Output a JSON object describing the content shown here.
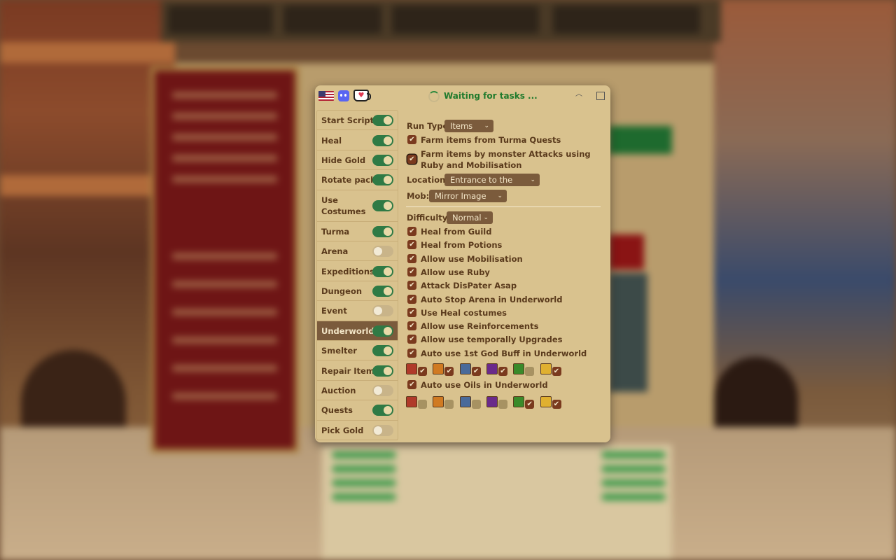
{
  "window": {
    "title": "Waiting for tasks ...",
    "kofi_glyph": "♥",
    "collapse_glyph": "︿"
  },
  "sidebar": {
    "items": [
      {
        "label": "Start Script",
        "on": true
      },
      {
        "label": "Heal",
        "on": true
      },
      {
        "label": "Hide Gold",
        "on": true
      },
      {
        "label": "Rotate packs",
        "on": true
      },
      {
        "label": "Use Costumes",
        "on": true
      },
      {
        "label": "Turma",
        "on": true
      },
      {
        "label": "Arena",
        "on": false
      },
      {
        "label": "Expeditions",
        "on": true
      },
      {
        "label": "Dungeon",
        "on": true
      },
      {
        "label": "Event",
        "on": false
      },
      {
        "label": "Underworld",
        "on": true,
        "active": true
      },
      {
        "label": "Smelter",
        "on": true
      },
      {
        "label": "Repair Items",
        "on": true
      },
      {
        "label": "Auction",
        "on": false
      },
      {
        "label": "Quests",
        "on": true
      },
      {
        "label": "Pick Gold",
        "on": false
      }
    ]
  },
  "main": {
    "run_type_label": "Run Type",
    "run_type_value": "Items",
    "farm_turma": "Farm items from Turma Quests",
    "farm_monster": "Farm items by monster Attacks using Ruby and Mobilisation",
    "location_label": "Location:",
    "location_value": "Entrance to the King...",
    "mob_label": "Mob:",
    "mob_value": "Mirror Image",
    "difficulty_label": "Difficulty",
    "difficulty_value": "Normal",
    "caret": "⌄",
    "check": "✔",
    "options": [
      "Heal from Guild",
      "Heal from Potions",
      "Allow use Mobilisation",
      "Allow use Ruby",
      "Attack DisPater Asap",
      "Auto Stop Arena in Underworld",
      "Use Heal costumes",
      "Allow use Reinforcements",
      "Allow use temporally Upgrades",
      "Auto use 1st God Buff in Underworld"
    ],
    "god_buffs": [
      {
        "icon": "mars-icon",
        "color": "#b03a2a",
        "checked": true
      },
      {
        "icon": "minerva-icon",
        "color": "#d07a22",
        "checked": true
      },
      {
        "icon": "diana-icon",
        "color": "#4a6a9a",
        "checked": true
      },
      {
        "icon": "apollo-icon",
        "color": "#6a2a8a",
        "checked": true
      },
      {
        "icon": "mercury-icon",
        "color": "#3a8a2a",
        "checked": false
      },
      {
        "icon": "vulcan-icon",
        "color": "#e0b030",
        "checked": true
      }
    ],
    "oils_label": "Auto use Oils in Underworld",
    "oils": [
      {
        "icon": "mars-oil-icon",
        "color": "#b03a2a",
        "checked": false
      },
      {
        "icon": "minerva-oil-icon",
        "color": "#d07a22",
        "checked": false
      },
      {
        "icon": "diana-oil-icon",
        "color": "#4a6a9a",
        "checked": false
      },
      {
        "icon": "apollo-oil-icon",
        "color": "#6a2a8a",
        "checked": false
      },
      {
        "icon": "mercury-oil-icon",
        "color": "#3a8a2a",
        "checked": true
      },
      {
        "icon": "vulcan-oil-icon",
        "color": "#e0b030",
        "checked": true
      }
    ]
  }
}
